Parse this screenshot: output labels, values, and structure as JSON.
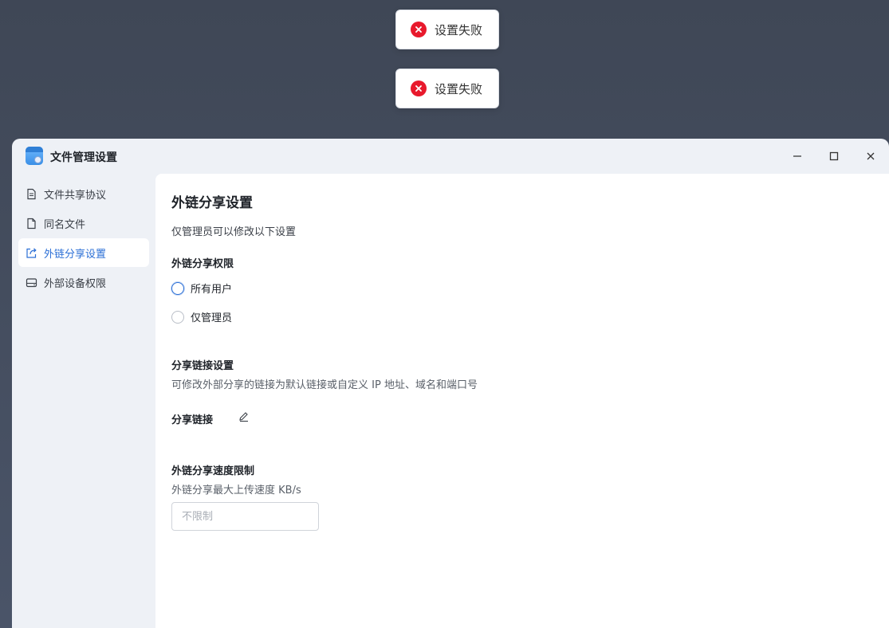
{
  "toasts": [
    {
      "message": "设置失败"
    },
    {
      "message": "设置失败"
    }
  ],
  "window": {
    "title": "文件管理设置",
    "icons": {
      "minimize": "minimize-icon",
      "maximize": "maximize-icon",
      "close": "close-icon"
    }
  },
  "sidebar": {
    "items": [
      {
        "label": "文件共享协议",
        "icon": "document-icon",
        "active": false
      },
      {
        "label": "同名文件",
        "icon": "file-icon",
        "active": false
      },
      {
        "label": "外链分享设置",
        "icon": "share-icon",
        "active": true
      },
      {
        "label": "外部设备权限",
        "icon": "drive-icon",
        "active": false
      }
    ]
  },
  "content": {
    "title": "外链分享设置",
    "note": "仅管理员可以修改以下设置",
    "permission": {
      "label": "外链分享权限",
      "options": [
        "所有用户",
        "仅管理员"
      ],
      "selected": null
    },
    "link_settings": {
      "label": "分享链接设置",
      "description": "可修改外部分享的链接为默认链接或自定义 IP 地址、域名和端口号",
      "field_label": "分享链接",
      "field_value": ""
    },
    "speed_limit": {
      "label": "外链分享速度限制",
      "description": "外链分享最大上传速度 KB/s",
      "value": "",
      "placeholder": "不限制"
    }
  },
  "colors": {
    "accent": "#2b6fd6",
    "error": "#e8192c",
    "sidebar_bg": "#eef1f6",
    "backdrop": "#434c5e"
  }
}
